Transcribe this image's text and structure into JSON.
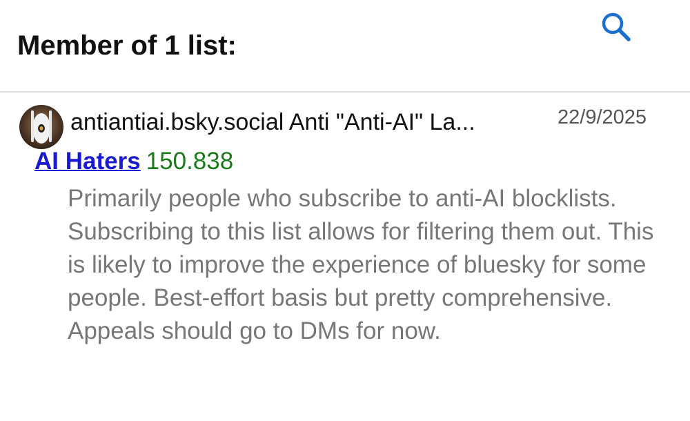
{
  "header": {
    "title": "Member of 1 list:",
    "search_icon": "search-icon",
    "accent_color": "#1a6fd1"
  },
  "list_entry": {
    "avatar_icon": "avatar",
    "handle_line": "antiantiai.bsky.social Anti \"Anti-AI\" La...",
    "date": "22/9/2025",
    "list_name": "AI Haters",
    "list_score": "150.838",
    "description": "Primarily people who subscribe to anti-AI blocklists. Subscribing to this list allows for filtering them out. This is likely to improve the experience of bluesky for some people. Best-effort basis but pretty comprehensive. Appeals should go to DMs for now."
  },
  "colors": {
    "link": "#1a1ad0",
    "score": "#1a7a1a",
    "description": "#777777",
    "divider": "#dcdcdc"
  }
}
